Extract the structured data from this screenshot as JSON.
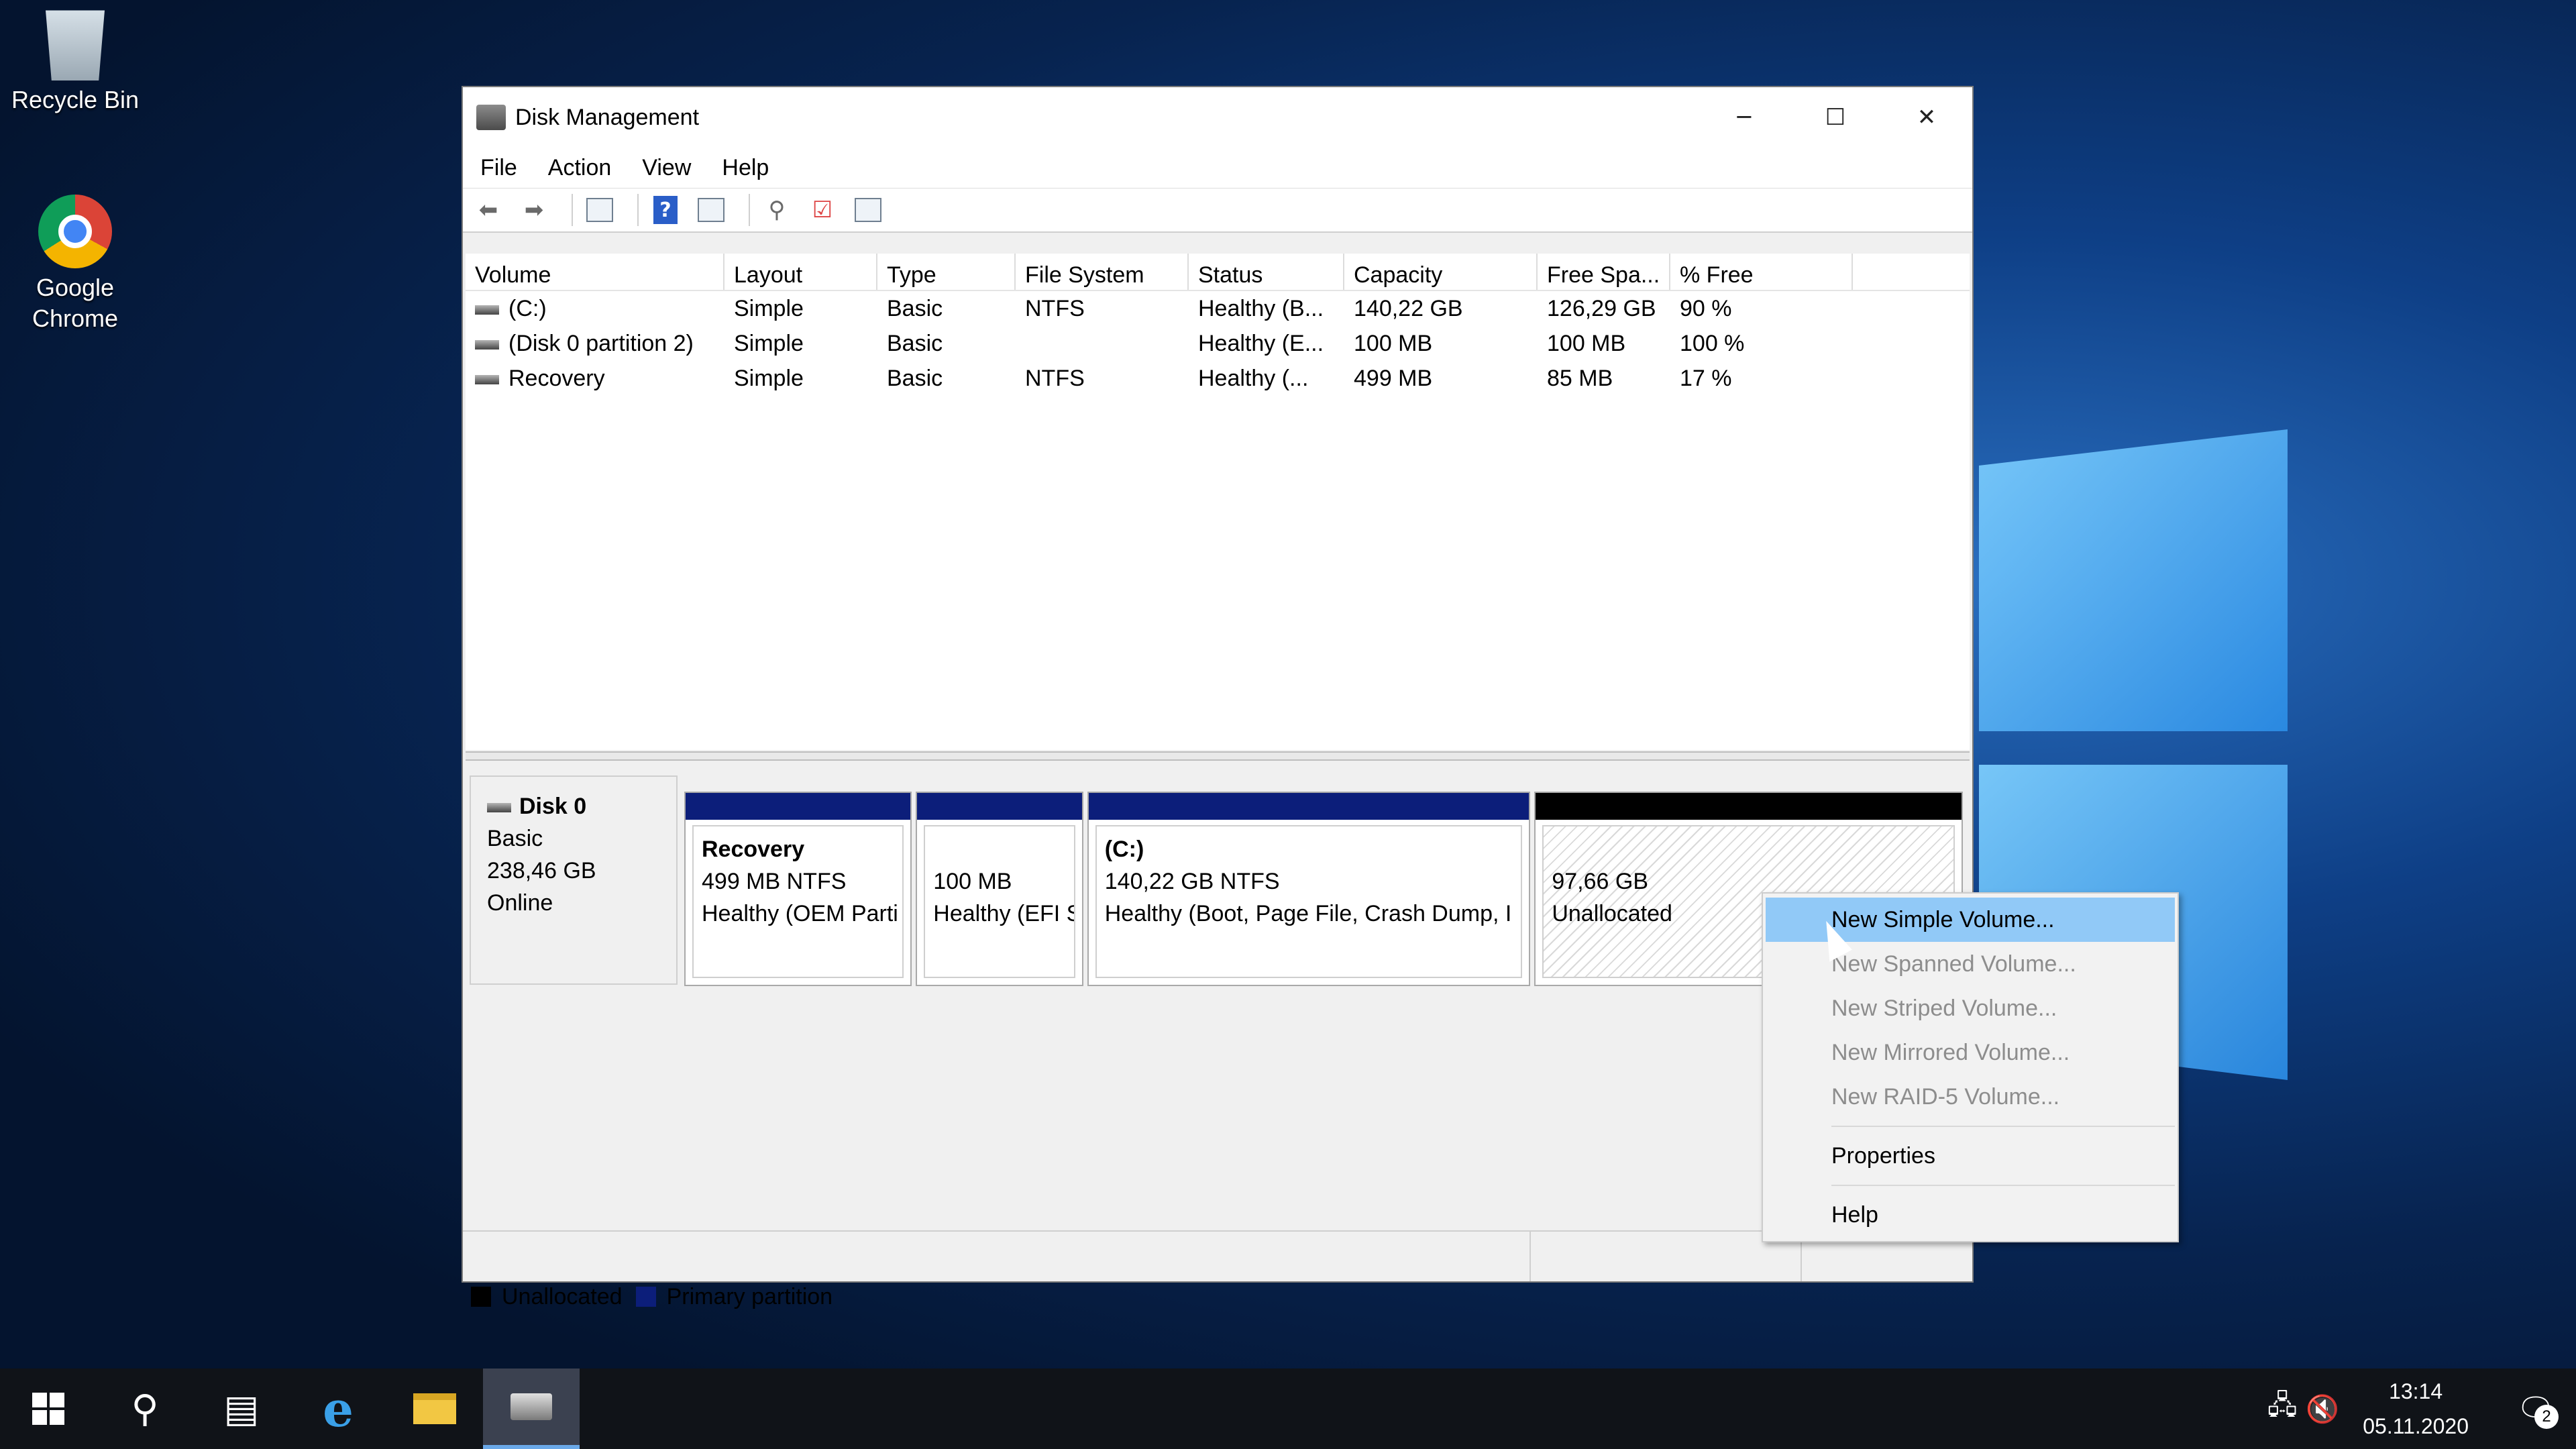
{
  "desktop": {
    "icons": [
      {
        "label": "Recycle Bin",
        "icon": "recycle-bin-icon"
      },
      {
        "label": "Google\nChrome",
        "icon": "chrome-icon"
      }
    ]
  },
  "window": {
    "title": "Disk Management",
    "controls": {
      "minimize": "─",
      "maximize": "☐",
      "close": "✕"
    },
    "menu": [
      "File",
      "Action",
      "View",
      "Help"
    ],
    "toolbar_icons": [
      "back-arrow-icon",
      "forward-arrow-icon",
      "disk-list-icon",
      "help-icon",
      "properties-icon",
      "connect-icon",
      "check-icon",
      "settings-icon"
    ]
  },
  "volume_list": {
    "columns": [
      "Volume",
      "Layout",
      "Type",
      "File System",
      "Status",
      "Capacity",
      "Free Spa...",
      "% Free"
    ],
    "rows": [
      {
        "volume": "(C:)",
        "layout": "Simple",
        "type": "Basic",
        "fs": "NTFS",
        "status": "Healthy (B...",
        "capacity": "140,22 GB",
        "free": "126,29 GB",
        "pct": "90 %"
      },
      {
        "volume": "(Disk 0 partition 2)",
        "layout": "Simple",
        "type": "Basic",
        "fs": "",
        "status": "Healthy (E...",
        "capacity": "100 MB",
        "free": "100 MB",
        "pct": "100 %"
      },
      {
        "volume": "Recovery",
        "layout": "Simple",
        "type": "Basic",
        "fs": "NTFS",
        "status": "Healthy (...",
        "capacity": "499 MB",
        "free": "85 MB",
        "pct": "17 %"
      }
    ]
  },
  "disk": {
    "name": "Disk 0",
    "type": "Basic",
    "size": "238,46 GB",
    "state": "Online",
    "partitions": [
      {
        "title": "Recovery",
        "line1": "499 MB NTFS",
        "line2": "Healthy (OEM Parti"
      },
      {
        "title": "",
        "line1": "100 MB",
        "line2": "Healthy (EFI S"
      },
      {
        "title": "(C:)",
        "line1": "140,22 GB NTFS",
        "line2": "Healthy (Boot, Page File, Crash Dump, I"
      },
      {
        "title": "",
        "line1": "97,66 GB",
        "line2": "Unallocated"
      }
    ]
  },
  "legend": {
    "unallocated": "Unallocated",
    "primary": "Primary partition",
    "unallocated_color": "#000000",
    "primary_color": "#0c1e7a"
  },
  "context_menu": {
    "items": [
      "New Simple Volume...",
      "New Spanned Volume...",
      "New Striped Volume...",
      "New Mirrored Volume...",
      "New RAID-5 Volume...",
      "Properties",
      "Help"
    ]
  },
  "taskbar": {
    "time": "13:14",
    "date": "05.11.2020",
    "notification_count": "2"
  }
}
